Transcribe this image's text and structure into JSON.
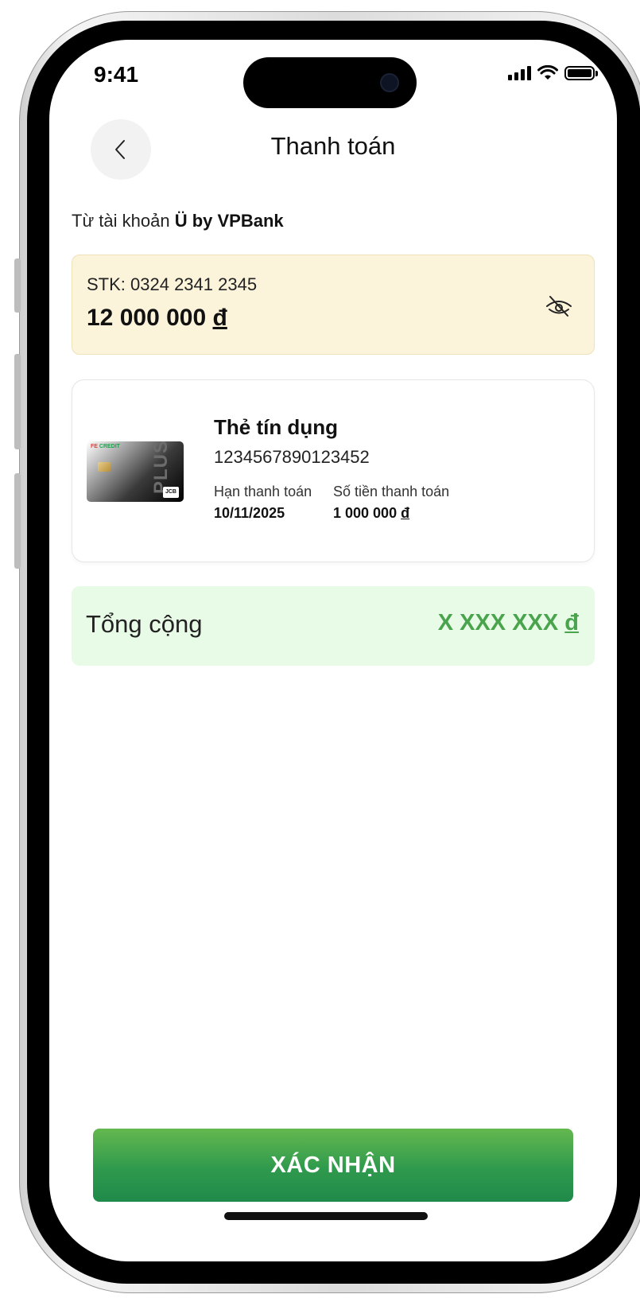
{
  "status_bar": {
    "time": "9:41"
  },
  "header": {
    "title": "Thanh toán",
    "back_icon": "chevron-left-icon"
  },
  "source_account": {
    "prefix": "Từ tài khoản",
    "bank_name": "Ü by VPBank",
    "account_number": "STK: 0324 2341 2345",
    "balance": "12 000 000",
    "currency": "đ",
    "visibility_icon": "eye-off-icon"
  },
  "credit_card": {
    "brand_fe": "FE",
    "brand_credit": "CREDIT",
    "card_art_text": "PLUS",
    "network": "JCB",
    "name": "Thẻ tín dụng",
    "number": "1234567890123452",
    "due_label": "Hạn thanh toán",
    "due_date": "10/11/2025",
    "amount_label": "Số tiền thanh toán",
    "amount": "1 000 000",
    "currency": "đ"
  },
  "total": {
    "label": "Tổng cộng",
    "value": "X XXX XXX",
    "currency": "đ"
  },
  "confirm_button": {
    "label": "XÁC NHẬN"
  },
  "colors": {
    "account_bg": "#fbf3da",
    "total_bg": "#e8fbe6",
    "total_text": "#4aa34d",
    "button_top": "#64b84f",
    "button_bottom": "#1f8a4a"
  }
}
